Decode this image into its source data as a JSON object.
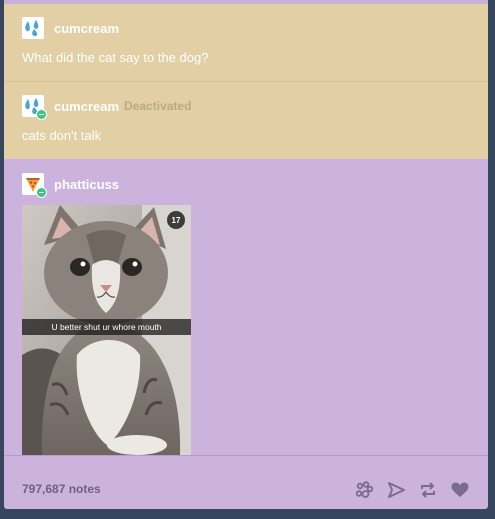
{
  "thread": [
    {
      "username": "cumcream",
      "status": "",
      "text": "What did the cat say to the dog?",
      "avatar_icon": "water-drops-icon",
      "background": "#e2cfa4"
    },
    {
      "username": "cumcream",
      "status": "Deactivated",
      "text": "cats don't talk",
      "avatar_icon": "water-drops-icon",
      "background": "#e2cfa4"
    },
    {
      "username": "phatticuss",
      "status": "",
      "avatar_icon": "pizza-slice-icon",
      "background": "#ccb3de",
      "photo": {
        "counter": "17",
        "caption": "U better shut ur whore mouth"
      }
    }
  ],
  "footer": {
    "notes": "797,687 notes",
    "actions": [
      "paw-icon",
      "share-icon",
      "reblog-icon",
      "heart-icon"
    ]
  },
  "colors": {
    "page_background": "#36465d",
    "tan": "#e2cfa4",
    "purple": "#ccb3de",
    "notes_text": "#6d6180",
    "action_icon": "#7b6a91",
    "online_badge": "#3ec383"
  }
}
